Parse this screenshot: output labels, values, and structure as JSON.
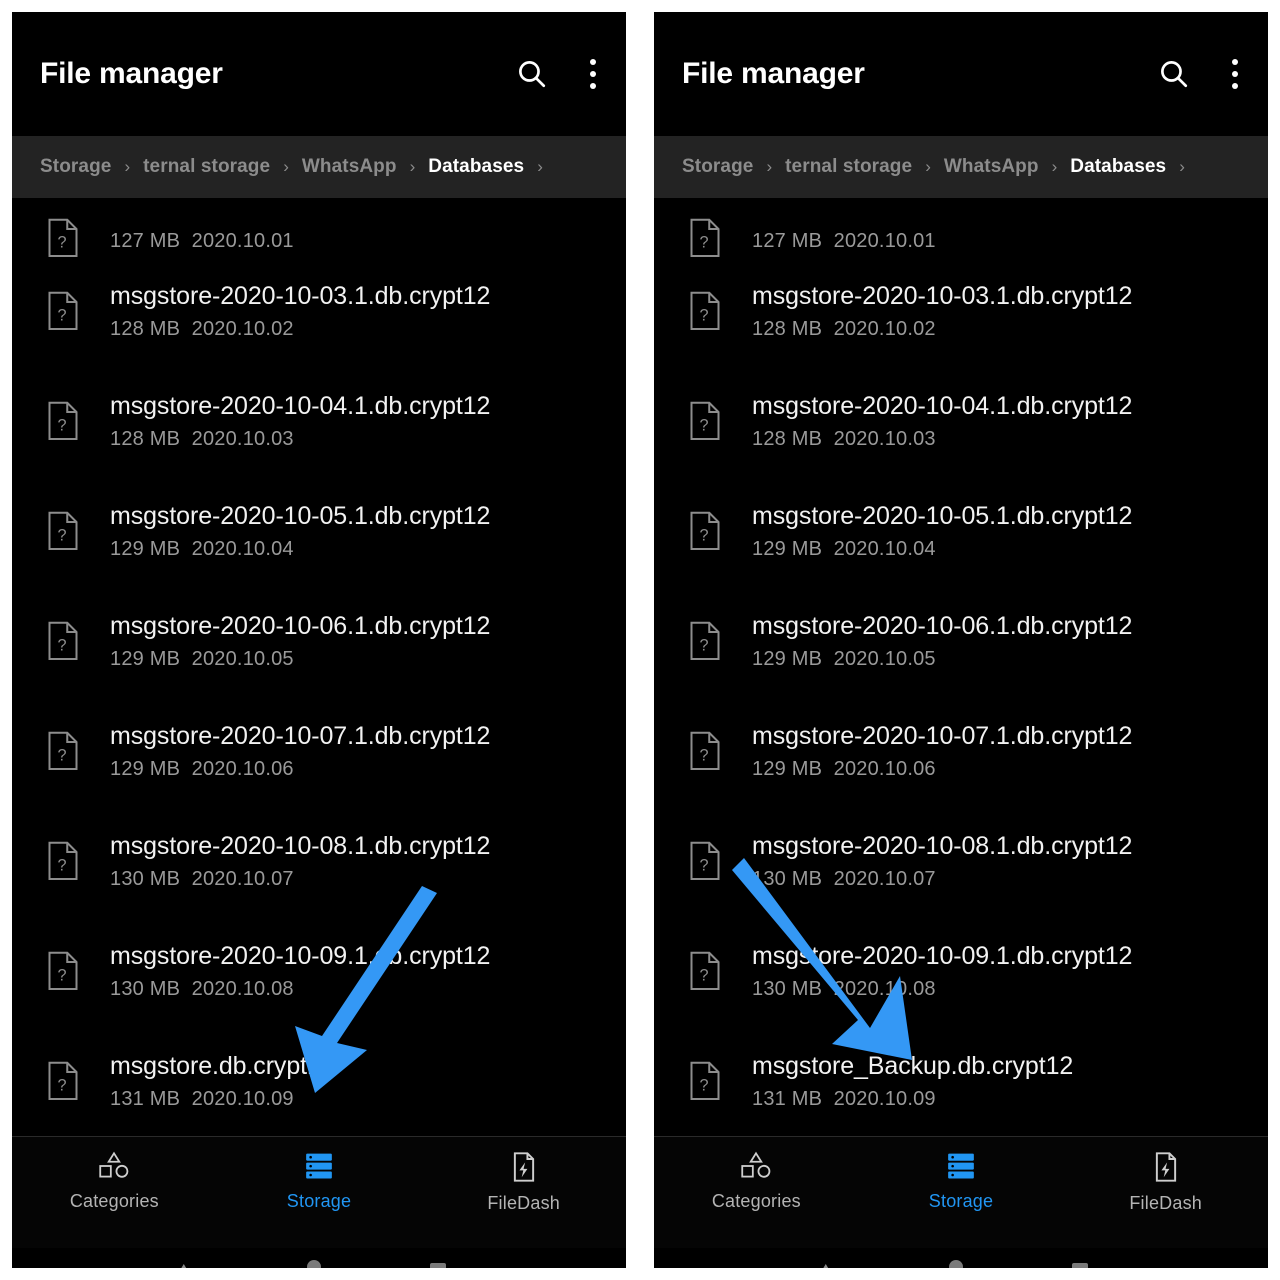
{
  "app": {
    "title": "File manager",
    "search_icon": "search-icon",
    "menu_icon": "overflow-menu-icon"
  },
  "breadcrumb": {
    "separator": "›",
    "items": [
      {
        "label": "Storage",
        "current": false
      },
      {
        "label": "ternal storage",
        "current": false
      },
      {
        "label": "WhatsApp",
        "current": false
      },
      {
        "label": "Databases",
        "current": true
      }
    ],
    "trailing_separator": "›"
  },
  "colors": {
    "accent": "#2196f3",
    "arrow": "#3498f5",
    "background": "#000000",
    "breadcrumb_bg": "#232323",
    "filename": "#f2f2f2",
    "filemeta": "#9a9a9a"
  },
  "bottom_nav": {
    "items": [
      {
        "label": "Categories",
        "icon": "shapes-icon",
        "active": false
      },
      {
        "label": "Storage",
        "icon": "storage-stack-icon",
        "active": true
      },
      {
        "label": "FileDash",
        "icon": "filedash-bolt-icon",
        "active": false
      }
    ]
  },
  "panels": [
    {
      "id": "left",
      "arrow": {
        "direction": "down-left",
        "name": "annotation-arrow-down-left"
      },
      "files": [
        {
          "name": "",
          "size": "127 MB",
          "date": "2020.10.01",
          "clipped": true
        },
        {
          "name": "msgstore-2020-10-03.1.db.crypt12",
          "size": "128 MB",
          "date": "2020.10.02",
          "clipped": false
        },
        {
          "name": "msgstore-2020-10-04.1.db.crypt12",
          "size": "128 MB",
          "date": "2020.10.03",
          "clipped": false
        },
        {
          "name": "msgstore-2020-10-05.1.db.crypt12",
          "size": "129 MB",
          "date": "2020.10.04",
          "clipped": false
        },
        {
          "name": "msgstore-2020-10-06.1.db.crypt12",
          "size": "129 MB",
          "date": "2020.10.05",
          "clipped": false
        },
        {
          "name": "msgstore-2020-10-07.1.db.crypt12",
          "size": "129 MB",
          "date": "2020.10.06",
          "clipped": false
        },
        {
          "name": "msgstore-2020-10-08.1.db.crypt12",
          "size": "130 MB",
          "date": "2020.10.07",
          "clipped": false
        },
        {
          "name": "msgstore-2020-10-09.1.db.crypt12",
          "size": "130 MB",
          "date": "2020.10.08",
          "clipped": false
        },
        {
          "name": "msgstore.db.crypt12",
          "size": "131 MB",
          "date": "2020.10.09",
          "clipped": false
        }
      ]
    },
    {
      "id": "right",
      "arrow": {
        "direction": "down-right",
        "name": "annotation-arrow-down-right"
      },
      "files": [
        {
          "name": "",
          "size": "127 MB",
          "date": "2020.10.01",
          "clipped": true
        },
        {
          "name": "msgstore-2020-10-03.1.db.crypt12",
          "size": "128 MB",
          "date": "2020.10.02",
          "clipped": false
        },
        {
          "name": "msgstore-2020-10-04.1.db.crypt12",
          "size": "128 MB",
          "date": "2020.10.03",
          "clipped": false
        },
        {
          "name": "msgstore-2020-10-05.1.db.crypt12",
          "size": "129 MB",
          "date": "2020.10.04",
          "clipped": false
        },
        {
          "name": "msgstore-2020-10-06.1.db.crypt12",
          "size": "129 MB",
          "date": "2020.10.05",
          "clipped": false
        },
        {
          "name": "msgstore-2020-10-07.1.db.crypt12",
          "size": "129 MB",
          "date": "2020.10.06",
          "clipped": false
        },
        {
          "name": "msgstore-2020-10-08.1.db.crypt12",
          "size": "130 MB",
          "date": "2020.10.07",
          "clipped": false
        },
        {
          "name": "msgstore-2020-10-09.1.db.crypt12",
          "size": "130 MB",
          "date": "2020.10.08",
          "clipped": false
        },
        {
          "name": "msgstore_Backup.db.crypt12",
          "size": "131 MB",
          "date": "2020.10.09",
          "clipped": false
        }
      ]
    }
  ]
}
